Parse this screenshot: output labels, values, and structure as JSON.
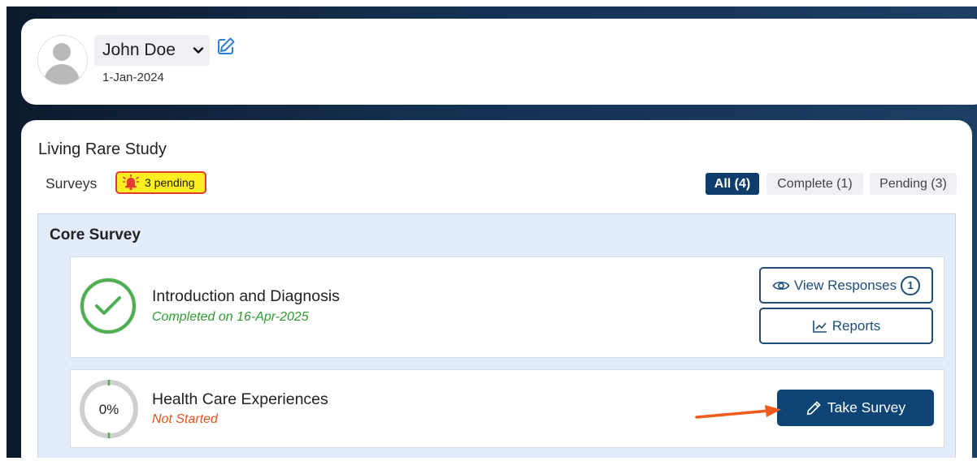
{
  "profile": {
    "name": "John Doe",
    "date": "1-Jan-2024"
  },
  "study": {
    "title": "Living Rare Study",
    "surveys_label": "Surveys",
    "pending_badge": "3 pending"
  },
  "filters": {
    "all": "All (4)",
    "complete": "Complete (1)",
    "pending": "Pending (3)"
  },
  "core_survey": {
    "title": "Core Survey",
    "surveys": [
      {
        "name": "Introduction and Diagnosis",
        "status": "Completed on 16-Apr-2025",
        "progress_percent": 100,
        "view_responses_label": "View Responses",
        "responses_count": "1",
        "reports_label": "Reports"
      },
      {
        "name": "Health Care Experiences",
        "status": "Not Started",
        "progress_label": "0%",
        "progress_percent": 0,
        "take_survey_label": "Take Survey"
      }
    ]
  },
  "colors": {
    "primary": "#0f4574",
    "complete_green": "#2e9b31",
    "not_started_orange": "#e5531b",
    "badge_yellow": "#fcee21",
    "badge_border": "#e53935",
    "annotation_arrow": "#f05a1a"
  },
  "icons": {
    "avatar": "person-placeholder",
    "dropdown": "chevron-down-icon",
    "edit": "edit-icon",
    "bell": "alarm-bell-icon",
    "check": "check-icon",
    "eye": "eye-icon",
    "chart": "line-chart-icon",
    "pencil": "pencil-icon"
  }
}
